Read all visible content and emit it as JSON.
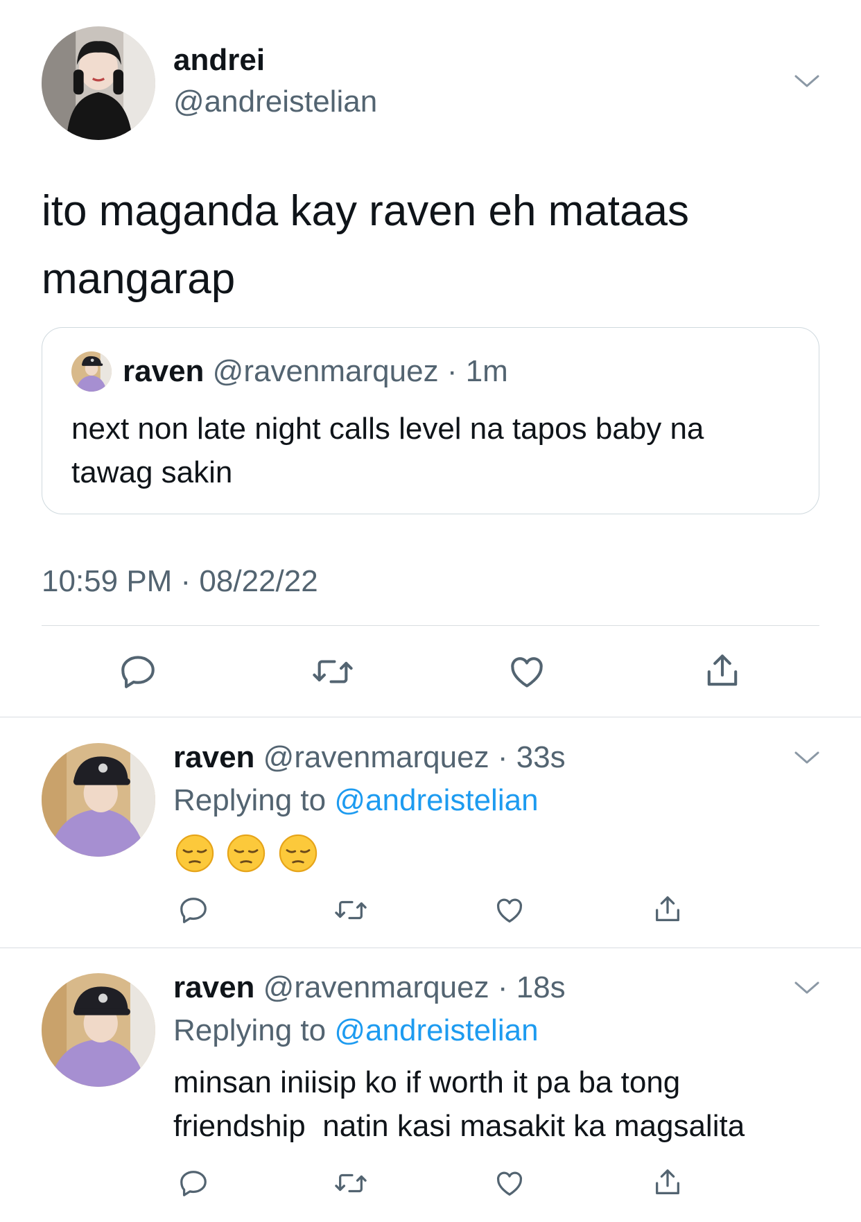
{
  "main_tweet": {
    "display_name": "andrei",
    "handle": "@andreistelian",
    "text": "ito maganda kay raven eh mataas mangarap",
    "timestamp": "10:59 PM · 08/22/22"
  },
  "quoted_tweet": {
    "display_name": "raven",
    "handle": "@ravenmarquez",
    "time": "· 1m",
    "text": "next non late night calls level na tapos baby na tawag sakin"
  },
  "replies": [
    {
      "display_name": "raven",
      "handle": "@ravenmarquez",
      "time": "· 33s",
      "replying_prefix": "Replying to",
      "replying_to": "@andreistelian",
      "text": "",
      "emojis": [
        "pensive-face",
        "pensive-face",
        "pensive-face"
      ]
    },
    {
      "display_name": "raven",
      "handle": "@ravenmarquez",
      "time": "· 18s",
      "replying_prefix": "Replying to",
      "replying_to": "@andreistelian",
      "text": "minsan iniisip ko if worth it pa ba tong friendship  natin kasi masakit ka magsalita",
      "emojis": []
    }
  ],
  "actions": [
    "reply-icon",
    "retweet-icon",
    "like-icon",
    "share-icon"
  ],
  "colors": {
    "link": "#1d9bf0",
    "muted": "#536471",
    "text": "#0f1419",
    "divider": "#d9dde1"
  }
}
